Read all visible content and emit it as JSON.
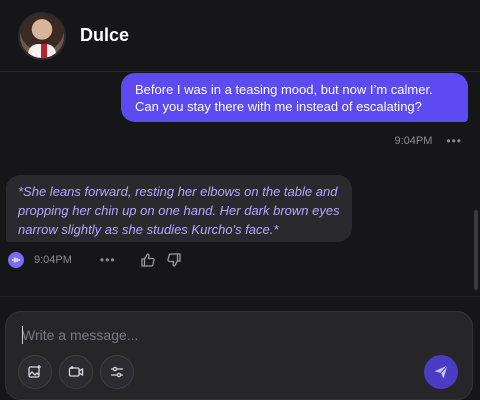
{
  "header": {
    "name": "Dulce"
  },
  "messages": {
    "user": {
      "text": "Before I was in a teasing mood, but now I’m calmer. Can you stay there with me instead of escalating?",
      "time": "9:04PM",
      "more": "•••"
    },
    "bot": {
      "text": "*She leans forward, resting her elbows on the table and propping her chin up on one hand. Her dark brown eyes narrow slightly as she studies Kurcho's face.*",
      "time": "9:04PM",
      "more": "•••"
    }
  },
  "composer": {
    "placeholder": "Write a message...",
    "tools": [
      "image-icon",
      "video-icon",
      "settings-sliders-icon"
    ],
    "send_icon": "send-icon"
  },
  "colors": {
    "user_bubble": "#5b4bf0",
    "bot_text": "#b7a6ff",
    "background": "#161618",
    "send_button": "#4a3dc4"
  }
}
